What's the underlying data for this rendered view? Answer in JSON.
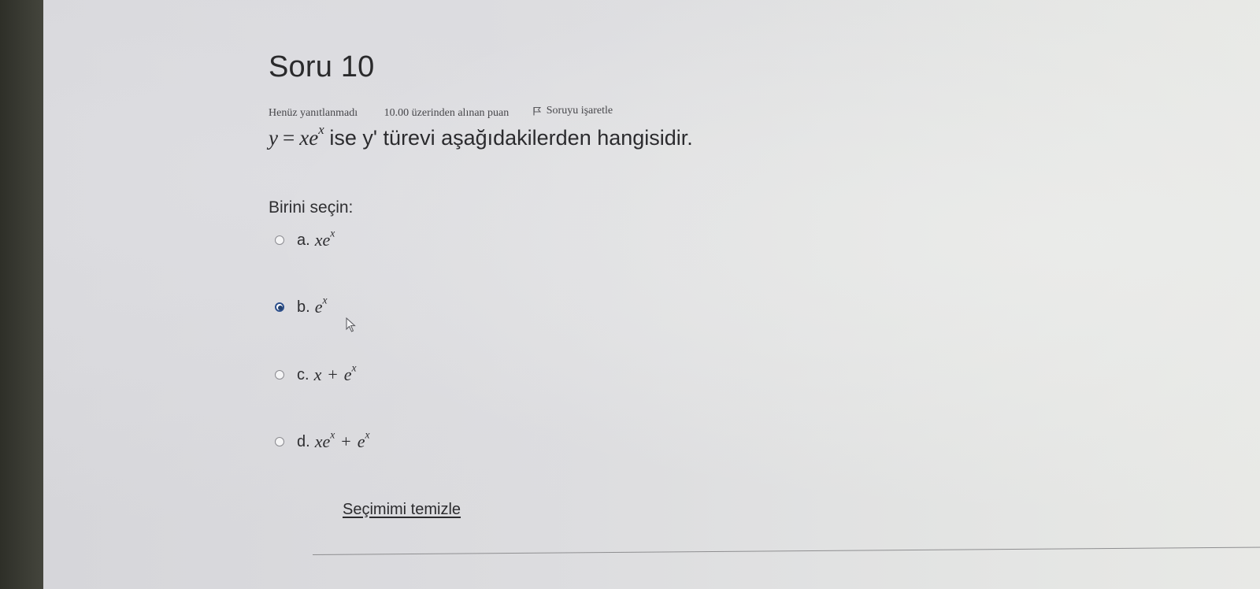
{
  "question": {
    "title": "Soru 10",
    "status": "Henüz yanıtlanmadı",
    "points": "10.00 üzerinden alınan puan",
    "flag_label": "Soruyu işaretle",
    "formula": {
      "lhs": "y",
      "op": "=",
      "rhs_base": "xe",
      "rhs_exp": "x"
    },
    "text": " ise y' türevi aşağıdakilerden hangisidir."
  },
  "prompt": "Birini seçin:",
  "options": [
    {
      "letter": "a.",
      "parts": [
        "xe",
        "x"
      ],
      "selected": false
    },
    {
      "letter": "b.",
      "parts": [
        "e",
        "x"
      ],
      "selected": true
    },
    {
      "letter": "c.",
      "parts": [
        "x",
        "+",
        "e",
        "x"
      ],
      "selected": false
    },
    {
      "letter": "d.",
      "parts": [
        "xe",
        "x",
        "+",
        "e",
        "x"
      ],
      "selected": false
    }
  ],
  "clear_link": "Seçimimi temizle",
  "icons": {
    "flag": "flag-icon",
    "cursor": "mouse-pointer-icon"
  },
  "colors": {
    "selected_radio": "#22406f",
    "text": "#2b2b2e"
  }
}
